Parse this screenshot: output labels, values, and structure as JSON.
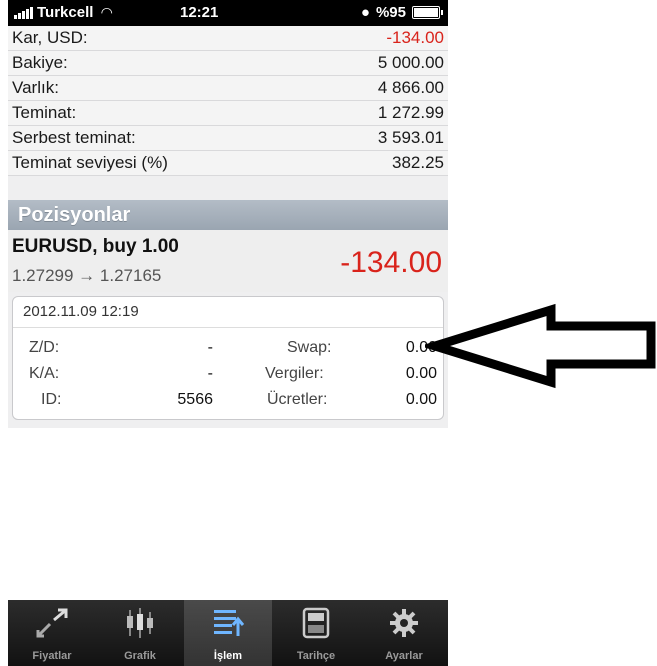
{
  "status": {
    "carrier": "Turkcell",
    "time": "12:21",
    "battery": "%95"
  },
  "summary": [
    {
      "label": "Kar, USD:",
      "value": "-134.00",
      "negative": true
    },
    {
      "label": "Bakiye:",
      "value": "5 000.00"
    },
    {
      "label": "Varlık:",
      "value": "4 866.00"
    },
    {
      "label": "Teminat:",
      "value": "1 272.99"
    },
    {
      "label": "Serbest teminat:",
      "value": "3 593.01"
    },
    {
      "label": "Teminat seviyesi (%)",
      "value": "382.25"
    }
  ],
  "section": {
    "title": "Pozisyonlar"
  },
  "position": {
    "symbol": "EURUSD, buy 1.00",
    "prices": "1.27299 → 1.27165",
    "profit": "-134.00",
    "datetime": "2012.11.09 12:19",
    "zd_label": "Z/D:",
    "zd_value": "-",
    "ka_label": "K/A:",
    "ka_value": "-",
    "id_label": "ID:",
    "id_value": "5566",
    "swap_label": "Swap:",
    "swap_value": "0.00",
    "taxes_label": "Vergiler:",
    "taxes_value": "0.00",
    "fees_label": "Ücretler:",
    "fees_value": "0.00"
  },
  "tabs": [
    {
      "label": "Fiyatlar",
      "icon": "quotes-arrows-icon",
      "active": false
    },
    {
      "label": "Grafik",
      "icon": "chart-candles-icon",
      "active": false
    },
    {
      "label": "İşlem",
      "icon": "trade-list-icon",
      "active": true
    },
    {
      "label": "Tarihçe",
      "icon": "history-box-icon",
      "active": false
    },
    {
      "label": "Ayarlar",
      "icon": "gear-icon",
      "active": false
    }
  ],
  "colors": {
    "negative": "#d9231b",
    "header": "#a7b0bb",
    "tabbar": "#1e1e1e"
  }
}
